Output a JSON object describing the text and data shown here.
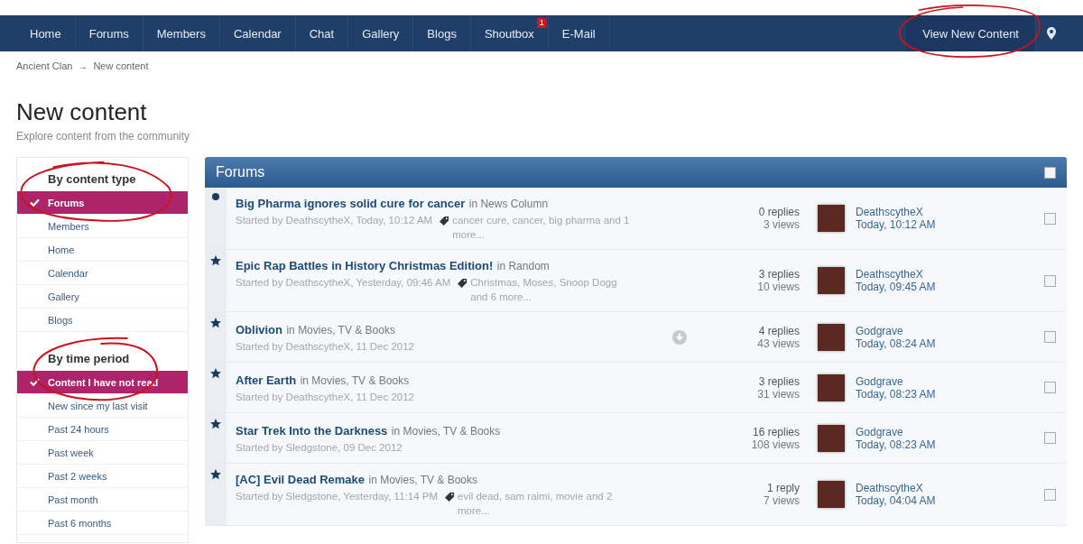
{
  "nav": {
    "items": [
      {
        "label": "Home"
      },
      {
        "label": "Forums"
      },
      {
        "label": "Members"
      },
      {
        "label": "Calendar"
      },
      {
        "label": "Chat"
      },
      {
        "label": "Gallery"
      },
      {
        "label": "Blogs"
      },
      {
        "label": "Shoutbox",
        "badge": "1"
      },
      {
        "label": "E-Mail"
      }
    ],
    "right_link": "View New Content"
  },
  "breadcrumb": [
    "Ancient Clan",
    "New content"
  ],
  "breadcrumb_separator": "→",
  "title": "New content",
  "subtitle": "Explore content from the community",
  "sidebar": {
    "sections": [
      {
        "heading": "By content type",
        "items": [
          {
            "label": "Forums",
            "selected": true
          },
          {
            "label": "Members",
            "selected": false
          },
          {
            "label": "Home",
            "selected": false
          },
          {
            "label": "Calendar",
            "selected": false
          },
          {
            "label": "Gallery",
            "selected": false
          },
          {
            "label": "Blogs",
            "selected": false
          }
        ]
      },
      {
        "heading": "By time period",
        "items": [
          {
            "label": "Content I have not read",
            "selected": true
          },
          {
            "label": "New since my last visit",
            "selected": false
          },
          {
            "label": "Past 24 hours",
            "selected": false
          },
          {
            "label": "Past week",
            "selected": false
          },
          {
            "label": "Past 2 weeks",
            "selected": false
          },
          {
            "label": "Past month",
            "selected": false
          },
          {
            "label": "Past 6 months",
            "selected": false
          }
        ]
      }
    ]
  },
  "panel": {
    "title": "Forums",
    "select_all_checked": false,
    "topics": [
      {
        "kind": "unread",
        "title": "Big Pharma ignores solid cure for cancer",
        "forum": "in News Column",
        "started": "Started by DeathscytheX, Today, 10:12 AM",
        "tags": "cancer cure, cancer, big pharma and 1 more...",
        "arrow_badge": false,
        "replies": "0 replies",
        "views": "3 views",
        "last_poster": "DeathscytheX",
        "last_time": "Today, 10:12 AM",
        "checked": false
      },
      {
        "kind": "starred",
        "title": "Epic Rap Battles in History Christmas Edition!",
        "forum": "in Random",
        "started": "Started by DeathscytheX, Yesterday, 09:46 AM",
        "tags": "Christmas, Moses, Snoop Dogg and 6 more...",
        "arrow_badge": false,
        "replies": "3 replies",
        "views": "10 views",
        "last_poster": "DeathscytheX",
        "last_time": "Today, 09:45 AM",
        "checked": false
      },
      {
        "kind": "starred",
        "title": "Oblivion",
        "forum": "in Movies, TV & Books",
        "started": "Started by DeathscytheX, 11 Dec 2012",
        "arrow_badge": true,
        "replies": "4 replies",
        "views": "43 views",
        "last_poster": "Godgrave",
        "last_time": "Today, 08:24 AM",
        "checked": false
      },
      {
        "kind": "starred",
        "title": "After Earth",
        "forum": "in Movies, TV & Books",
        "started": "Started by DeathscytheX, 11 Dec 2012",
        "arrow_badge": false,
        "replies": "3 replies",
        "views": "31 views",
        "last_poster": "Godgrave",
        "last_time": "Today, 08:23 AM",
        "checked": false
      },
      {
        "kind": "starred",
        "title": "Star Trek Into the Darkness",
        "forum": "in Movies, TV & Books",
        "started": "Started by Sledgstone, 09 Dec 2012",
        "arrow_badge": false,
        "replies": "16 replies",
        "views": "108 views",
        "last_poster": "Godgrave",
        "last_time": "Today, 08:23 AM",
        "checked": false
      },
      {
        "kind": "starred",
        "title": "[AC] Evil Dead Remake",
        "forum": "in Movies, TV & Books",
        "started": "Started by Sledgstone, Yesterday, 11:14 PM",
        "tags": "evil dead, sam raimi, movie and 2 more...",
        "arrow_badge": false,
        "replies": "1 reply",
        "views": "7 views",
        "last_poster": "DeathscytheX",
        "last_time": "Today, 04:04 AM",
        "checked": false
      }
    ]
  }
}
